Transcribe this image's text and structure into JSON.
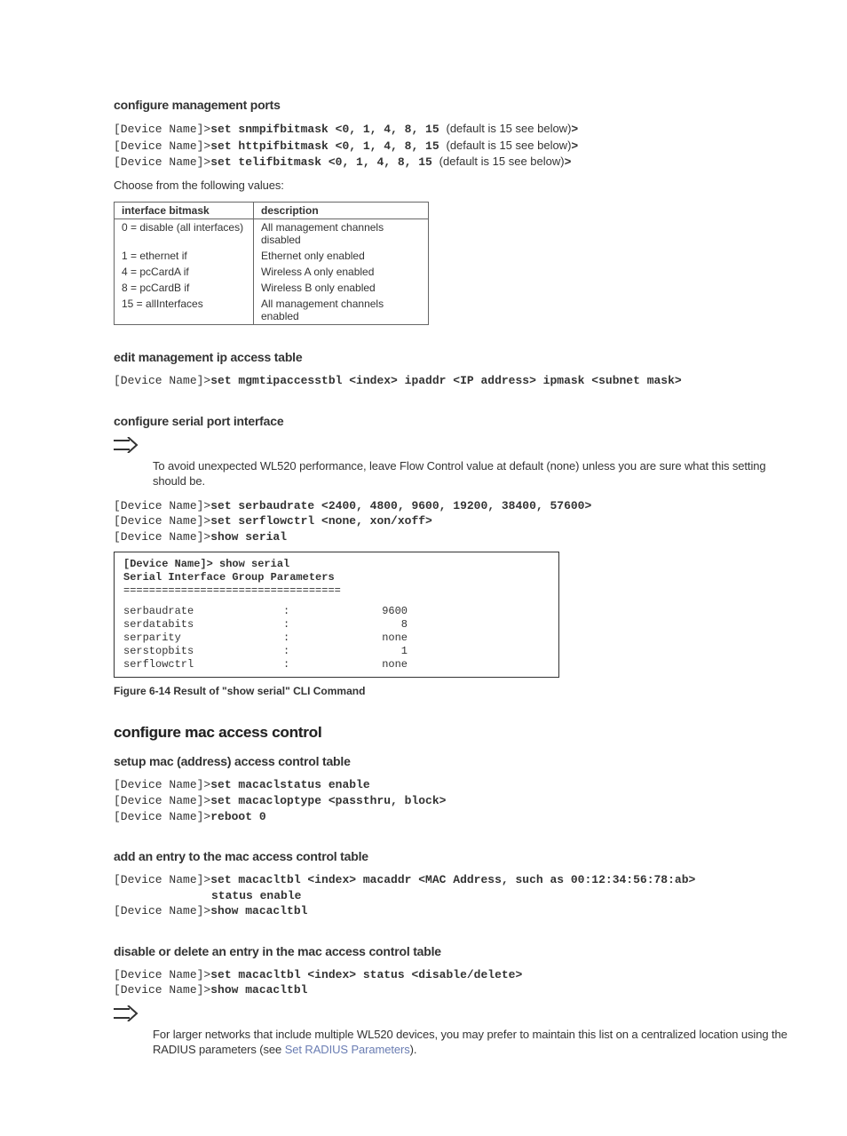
{
  "s1": {
    "heading": "configure management ports",
    "lines": [
      {
        "prefix": "[Device Name]>",
        "cmd": "set snmpifbitmask <0, 1, 4, 8, 15 ",
        "note_open": "(",
        "note": "default is 15 ",
        "note_tail": "see below)",
        "cmd_close": ">"
      },
      {
        "prefix": "[Device Name]>",
        "cmd": "set httpifbitmask <0, 1, 4, 8, 15 ",
        "note_open": "(",
        "note": "default is 15 ",
        "note_tail": "see below)",
        "cmd_close": ">"
      },
      {
        "prefix": "[Device Name]>",
        "cmd": "set telifbitmask <0, 1, 4, 8, 15 ",
        "note_open": "(",
        "note": "default is 15 ",
        "note_tail": "see below)",
        "cmd_close": ">"
      }
    ],
    "choose": "Choose from the following values:",
    "table": {
      "h1": "interface bitmask",
      "h2": "description",
      "rows": [
        {
          "a": "0 = disable (all interfaces)",
          "b": "All management channels disabled"
        },
        {
          "a": "1 = ethernet if",
          "b": "Ethernet only enabled"
        },
        {
          "a": "4 = pcCardA if",
          "b": "Wireless A only enabled"
        },
        {
          "a": "8 = pcCardB if",
          "b": "Wireless B only enabled"
        },
        {
          "a": "15 = allInterfaces",
          "b": "All management channels enabled"
        }
      ]
    }
  },
  "s2": {
    "heading": "edit management ip access table",
    "line": {
      "prefix": "[Device Name]>",
      "cmd": "set mgmtipaccesstbl <index> ipaddr <IP address> ipmask <subnet mask>"
    }
  },
  "s3": {
    "heading": "configure serial port interface",
    "note": "To avoid unexpected WL520 performance, leave Flow Control value at default (none) unless you are sure what this setting should be.",
    "lines": [
      {
        "prefix": "[Device Name]>",
        "cmd": "set serbaudrate <2400, 4800, 9600, 19200, 38400, 57600>"
      },
      {
        "prefix": "[Device Name]>",
        "cmd": "set serflowctrl <none, xon/xoff>"
      },
      {
        "prefix": "[Device Name]>",
        "cmd": "show serial"
      }
    ],
    "box": {
      "h1": "[Device Name]> show serial",
      "h2": "Serial Interface Group Parameters",
      "sep": "==================================",
      "rows": [
        {
          "k": "serbaudrate",
          "c": ":",
          "v": "9600"
        },
        {
          "k": "serdatabits",
          "c": ":",
          "v": "8"
        },
        {
          "k": "serparity",
          "c": ":",
          "v": "none"
        },
        {
          "k": "serstopbits",
          "c": ":",
          "v": "1"
        },
        {
          "k": "serflowctrl",
          "c": ":",
          "v": "none"
        }
      ]
    },
    "caption": "Figure 6-14   Result of \"show serial\" CLI Command"
  },
  "s4": {
    "heading": "configure mac access control",
    "sub1": {
      "heading": "setup mac (address) access control table",
      "lines": [
        {
          "prefix": "[Device Name]>",
          "cmd": "set macaclstatus enable"
        },
        {
          "prefix": "[Device Name]>",
          "cmd": "set macacloptype <passthru, block>"
        },
        {
          "prefix": "[Device Name]>",
          "cmd": "reboot 0"
        }
      ]
    },
    "sub2": {
      "heading": "add an entry to the mac access control table",
      "lines": [
        {
          "prefix": "[Device Name]>",
          "cmd": "set macacltbl <index> macaddr <MAC Address, such as 00:12:34:56:78:ab> "
        },
        {
          "prefix": "",
          "cmd": "status enable",
          "indent": true
        },
        {
          "prefix": "[Device Name]>",
          "cmd": "show macacltbl"
        }
      ]
    },
    "sub3": {
      "heading": "disable or delete an entry in the mac access control table",
      "lines": [
        {
          "prefix": "[Device Name]>",
          "cmd": "set macacltbl <index> status <disable/delete>"
        },
        {
          "prefix": "[Device Name]>",
          "cmd": "show macacltbl"
        }
      ],
      "note_pre": "For larger networks that include multiple WL520 devices, you may prefer to maintain this list on a centralized location using the RADIUS parameters (see ",
      "link": "Set RADIUS Parameters",
      "note_post": ")."
    }
  }
}
